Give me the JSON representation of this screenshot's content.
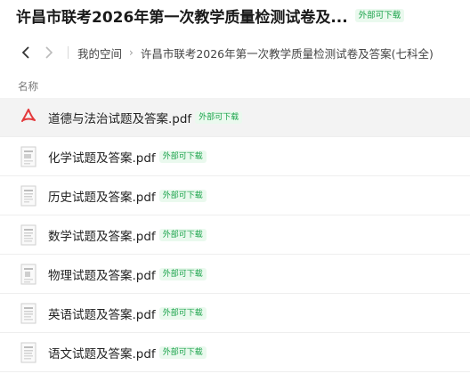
{
  "header": {
    "title": "许昌市联考2026年第一次教学质量检测试卷及...",
    "badge": "外部可下载"
  },
  "navbar": {
    "back_icon": "chevron-left-icon",
    "forward_icon": "chevron-right-icon",
    "breadcrumbs": [
      "我的空间",
      "许昌市联考2026年第一次教学质量检测试卷及答案(七科全)"
    ],
    "separator": "›"
  },
  "list_header": {
    "name_label": "名称"
  },
  "files": [
    {
      "name": "道德与法治试题及答案.pdf",
      "badge": "外部可下载",
      "icon": "pdf-icon",
      "selected": true
    },
    {
      "name": "化学试题及答案.pdf",
      "badge": "外部可下载",
      "icon": "document-thumbnail-icon"
    },
    {
      "name": "历史试题及答案.pdf",
      "badge": "外部可下载",
      "icon": "document-thumbnail-icon"
    },
    {
      "name": "数学试题及答案.pdf",
      "badge": "外部可下载",
      "icon": "document-thumbnail-icon"
    },
    {
      "name": "物理试题及答案.pdf",
      "badge": "外部可下载",
      "icon": "document-thumbnail-icon"
    },
    {
      "name": "英语试题及答案.pdf",
      "badge": "外部可下载",
      "icon": "document-thumbnail-icon"
    },
    {
      "name": "语文试题及答案.pdf",
      "badge": "外部可下载",
      "icon": "document-thumbnail-icon"
    }
  ],
  "colors": {
    "badge_text": "#1aa34a",
    "badge_bg": "#eaf9ee",
    "pdf_red": "#e4393c",
    "selected_row": "#f3f3f3"
  }
}
